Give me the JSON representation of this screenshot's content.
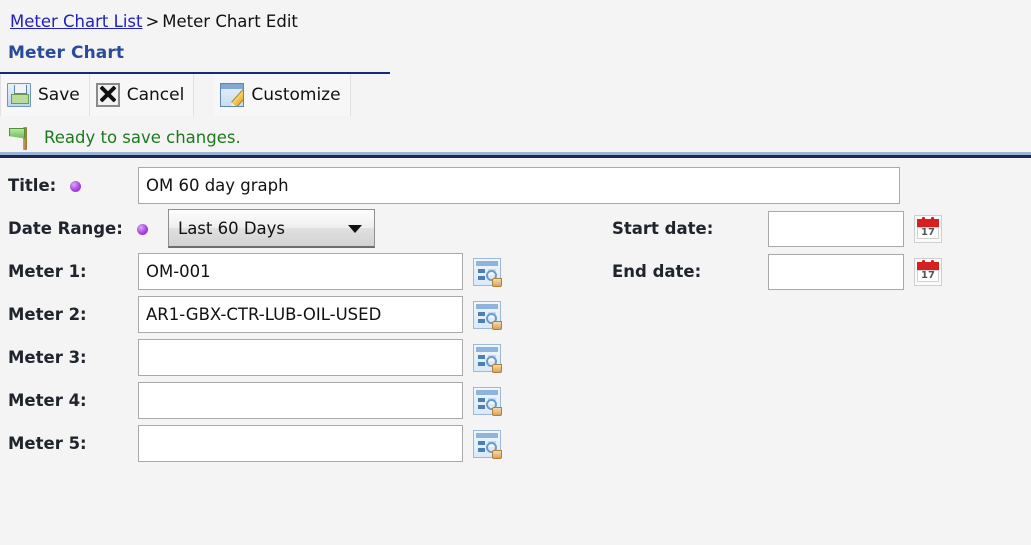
{
  "breadcrumb": {
    "link_label": "Meter Chart List",
    "separator": ">",
    "current_label": "Meter Chart Edit"
  },
  "page": {
    "title": "Meter Chart"
  },
  "toolbar": {
    "save_label": "Save",
    "cancel_label": "Cancel",
    "customize_label": "Customize",
    "icons": {
      "save": "floppy-disk-icon",
      "cancel": "cancel-x-icon",
      "customize": "window-pencil-icon"
    }
  },
  "status": {
    "icon": "green-flag-icon",
    "text": "Ready to save changes.",
    "color": "#1c7a1c"
  },
  "form": {
    "title_field": {
      "label": "Title:",
      "required": true,
      "value": "OM 60 day graph",
      "placeholder": ""
    },
    "date_range_field": {
      "label": "Date Range:",
      "required": true,
      "selected": "Last 60 Days",
      "options": [
        "Last 60 Days"
      ]
    },
    "meters": [
      {
        "label": "Meter 1:",
        "value": "OM-001",
        "placeholder": ""
      },
      {
        "label": "Meter 2:",
        "value": "AR1-GBX-CTR-LUB-OIL-USED",
        "placeholder": ""
      },
      {
        "label": "Meter 3:",
        "value": "",
        "placeholder": ""
      },
      {
        "label": "Meter 4:",
        "value": "",
        "placeholder": ""
      },
      {
        "label": "Meter 5:",
        "value": "",
        "placeholder": ""
      }
    ],
    "start_date_field": {
      "label": "Start date:",
      "value": "",
      "placeholder": ""
    },
    "end_date_field": {
      "label": "End date:",
      "value": "",
      "placeholder": ""
    },
    "calendar_icon_day": "17",
    "lookup_icon_name": "record-lookup-icon",
    "calendar_icon_name": "calendar-picker-icon",
    "required_marker_color": "#a844e0"
  }
}
